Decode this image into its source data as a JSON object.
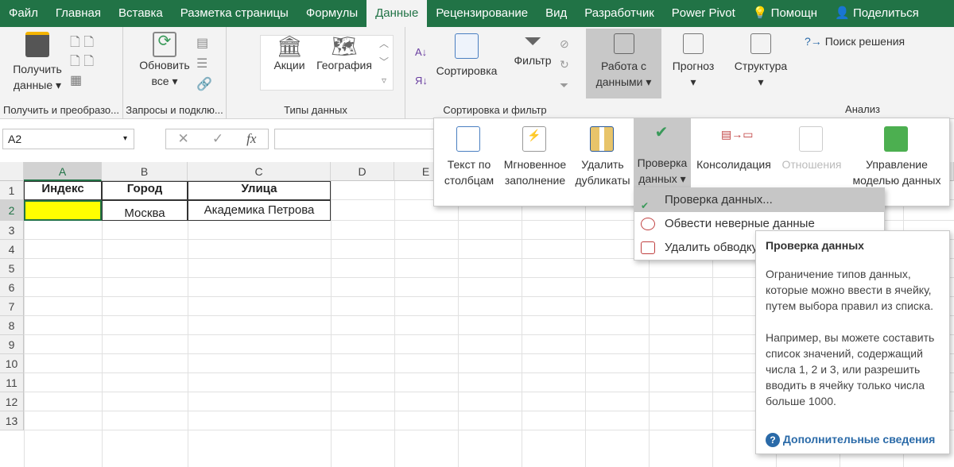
{
  "tabs": [
    "Файл",
    "Главная",
    "Вставка",
    "Разметка страницы",
    "Формулы",
    "Данные",
    "Рецензирование",
    "Вид",
    "Разработчик",
    "Power Pivot",
    "Помощн",
    "Поделиться"
  ],
  "ribbon": {
    "get_data": {
      "line1": "Получить",
      "line2": "данные",
      "group": "Получить и преобразо..."
    },
    "refresh": {
      "line1": "Обновить",
      "line2": "все",
      "group": "Запросы и подклю..."
    },
    "data_types": {
      "stocks": "Акции",
      "geography": "География",
      "group": "Типы данных"
    },
    "sort": {
      "label": "Сортировка",
      "filter": "Фильтр",
      "group": "Сортировка и фильтр"
    },
    "data_tools": {
      "line1": "Работа с",
      "line2": "данными"
    },
    "forecast": "Прогноз",
    "outline": "Структура",
    "solver": "Поиск решения",
    "analysis_group": "Анализ"
  },
  "formula_bar": {
    "name_box": "A2",
    "value": ""
  },
  "columns": [
    "A",
    "B",
    "C",
    "D",
    "E"
  ],
  "rows": [
    "1",
    "2",
    "3",
    "4",
    "5",
    "6",
    "7",
    "8",
    "9",
    "10",
    "11",
    "12",
    "13"
  ],
  "cells": {
    "A1": "Индекс",
    "B1": "Город",
    "C1": "Улица",
    "B2": "Москва",
    "C2": "Академика Петрова"
  },
  "panel": {
    "text_to_cols": [
      "Текст по",
      "столбцам"
    ],
    "flash_fill": [
      "Мгновенное",
      "заполнение"
    ],
    "remove_dup": [
      "Удалить",
      "дубликаты"
    ],
    "validation": [
      "Проверка",
      "данных"
    ],
    "consolidate": "Консолидация",
    "relations": "Отношения",
    "model": [
      "Управление",
      "моделью данных"
    ]
  },
  "menu": [
    "Проверка данных...",
    "Обвести неверные данные",
    "Удалить обводку"
  ],
  "tooltip": {
    "title": "Проверка данных",
    "p1": "Ограничение типов данных, которые можно ввести в ячейку, путем выбора правил из списка.",
    "p2": "Например, вы можете составить список значений, содержащий числа 1, 2 и 3, или разрешить вводить в ячейку только числа больше 1000.",
    "more": "Дополнительные сведения"
  },
  "colors": {
    "excel_green": "#217346",
    "selection": "#ffff00"
  }
}
